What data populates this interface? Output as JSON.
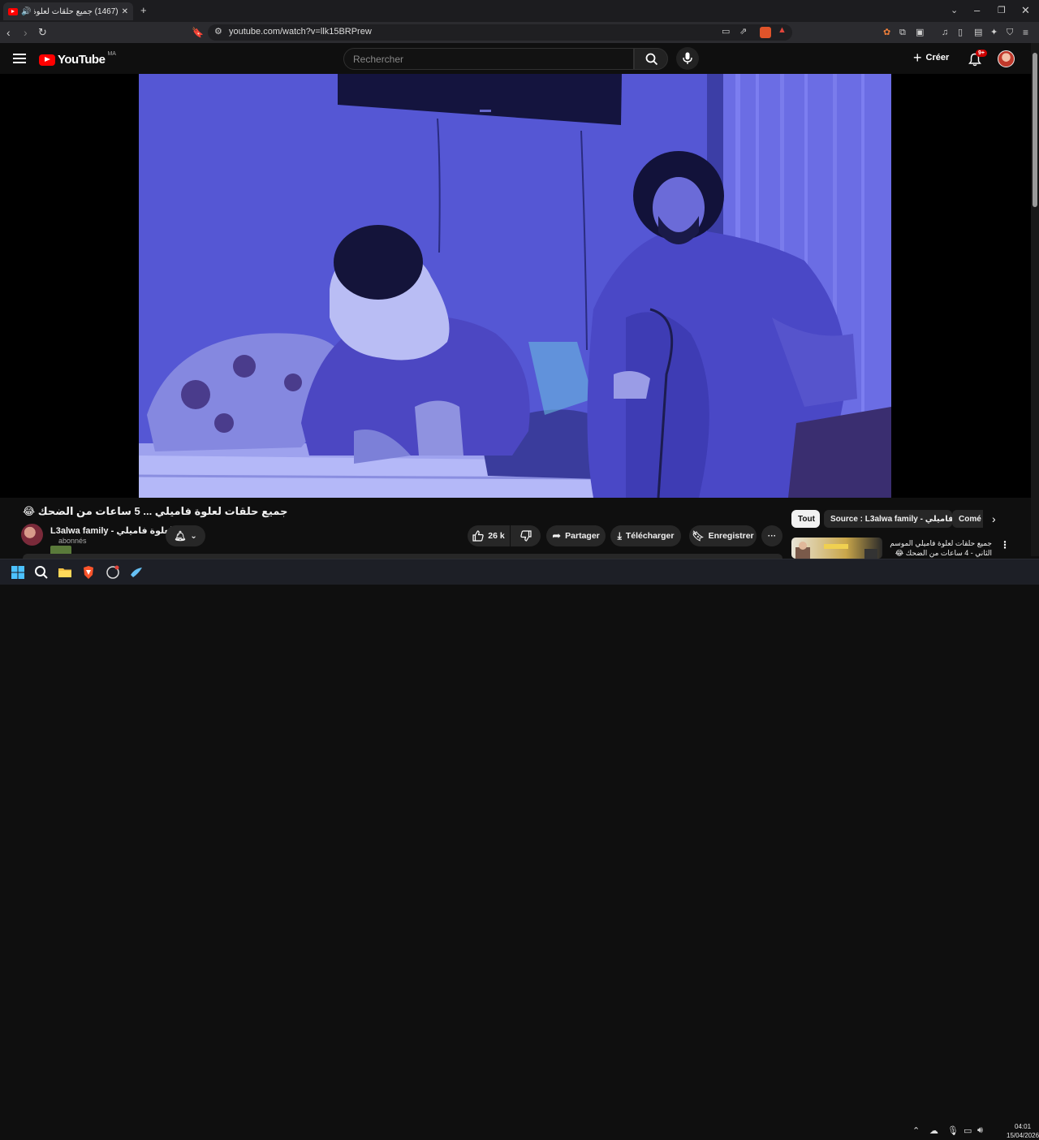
{
  "browser": {
    "tab_title": "(1467) جميع حلقات لعلوة",
    "new_tab": "+",
    "url": "youtube.com/watch?v=llk15BRPrew",
    "window_controls": [
      "chevron-down",
      "minimize",
      "restore",
      "close"
    ]
  },
  "youtube": {
    "logo_text": "YouTube",
    "region": "MA",
    "search_placeholder": "Rechercher",
    "create_label": "Créer",
    "notifications_badge": "9+"
  },
  "video": {
    "title": "جميع حلقات لعلوة فاميلي ... 5 ساعات من الضحك 😂",
    "channel_name": "L3alwa family - لعلوة فاميلي",
    "subscribers": "abonnés",
    "likes": "26 k",
    "share_label": "Partager",
    "download_label": "Télécharger",
    "save_label": "Enregistrer",
    "more_label": "···"
  },
  "sidebar": {
    "chips": [
      "Tout",
      "Source : L3alwa family - لعلوة فاميلي",
      "Comé"
    ],
    "recommendation": {
      "title": "جميع حلقات لعلوة فاميلي الموسم الثاني - 4 ساعات من الضحك 😂"
    }
  },
  "taskbar": {
    "time": "04:01",
    "date": "15/04/2026"
  },
  "colors": {
    "yt_red": "#ff0000",
    "bg": "#0f0f0f",
    "chip_active": "#f1f1f1"
  }
}
